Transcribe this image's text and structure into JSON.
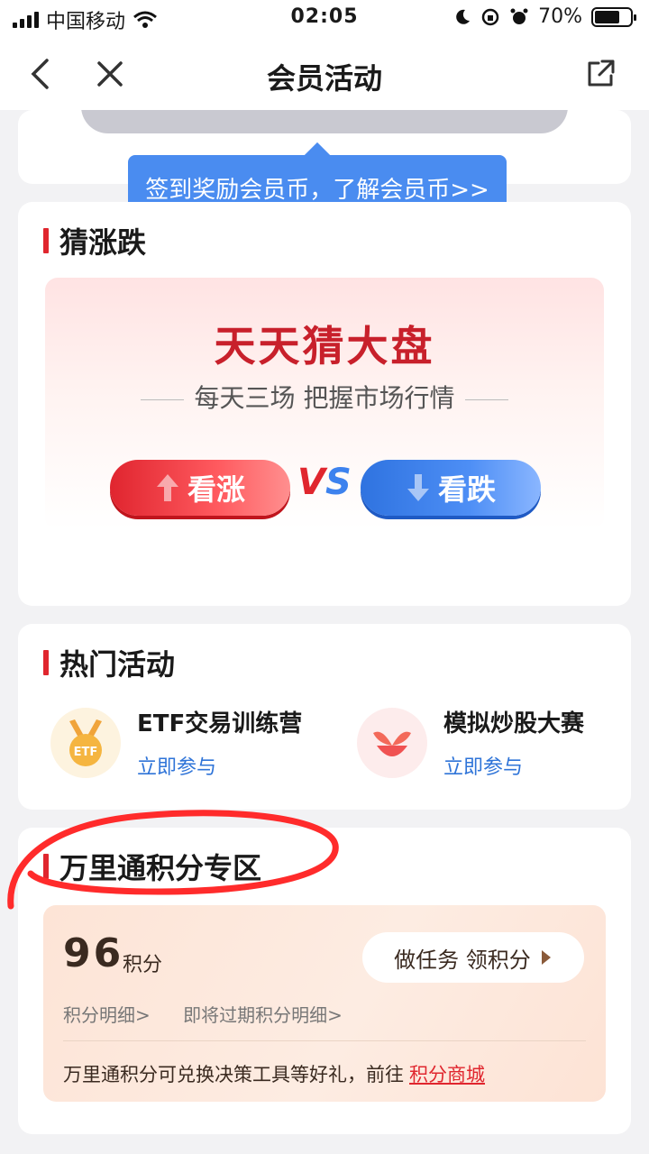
{
  "status_bar": {
    "carrier": "中国移动",
    "time": "02:05",
    "battery": "70%",
    "battery_level": 0.7
  },
  "nav": {
    "title": "会员活动"
  },
  "top_card": {
    "tooltip": "签到奖励会员币，了解会员币>>"
  },
  "guess": {
    "section_title": "猜涨跌",
    "title": "天天猜大盘",
    "subtitle": "每天三场 把握市场行情",
    "up_label": "看涨",
    "down_label": "看跌",
    "vs_v": "V",
    "vs_s": "S"
  },
  "hot": {
    "section_title": "热门活动",
    "items": [
      {
        "name": "ETF交易训练营",
        "link": "立即参与",
        "icon": "medal-icon",
        "icon_text": "ETF"
      },
      {
        "name": "模拟炒股大赛",
        "link": "立即参与",
        "icon": "sprout-icon"
      }
    ]
  },
  "points": {
    "section_title": "万里通积分专区",
    "value": "96",
    "unit": "积分",
    "task_button": "做任务 领积分",
    "link_detail": "积分明细>",
    "link_expiring": "即将过期积分明细>",
    "note": "万里通积分可兑换决策工具等好礼，前往",
    "mall_link": "积分商城"
  },
  "colors": {
    "accent": "#e0262e",
    "tooltip": "#4a8cf0",
    "link": "#2f74d8"
  }
}
